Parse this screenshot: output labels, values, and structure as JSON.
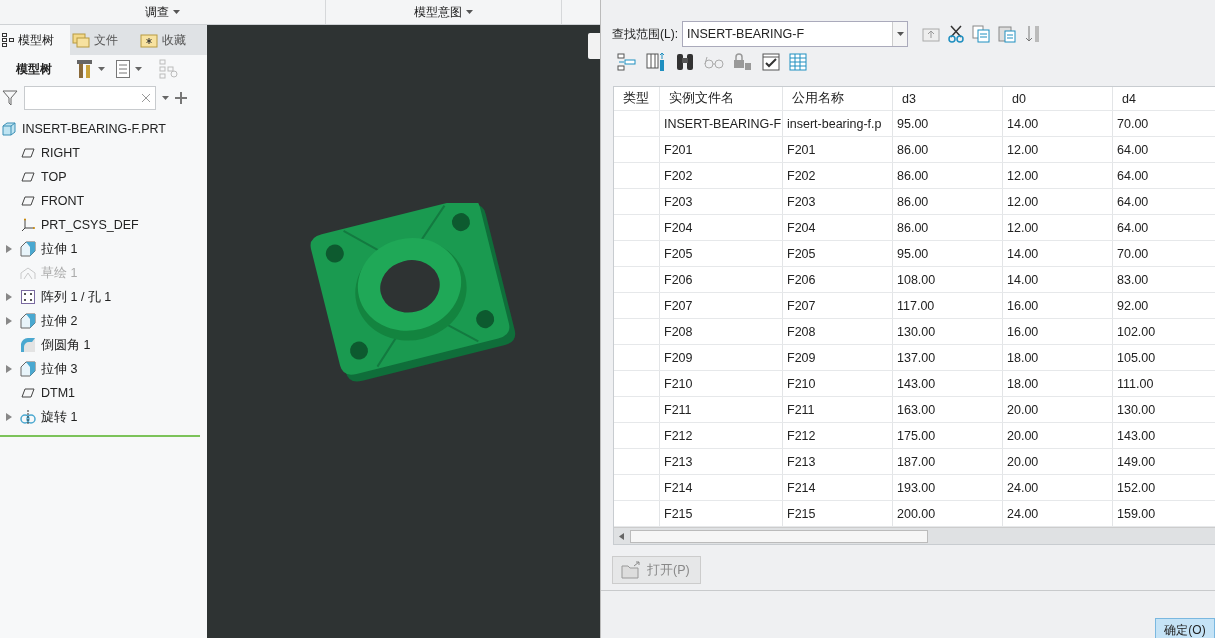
{
  "ribbon": {
    "groups": [
      {
        "label": "调查"
      },
      {
        "label": "模型意图"
      }
    ]
  },
  "navigator": {
    "tabs": [
      {
        "label": "模型树",
        "kind": "tree",
        "selected": true
      },
      {
        "label": "文件",
        "kind": "folder",
        "selected": false
      },
      {
        "label": "收藏",
        "kind": "favorites",
        "selected": false
      }
    ],
    "toolbar_label": "模型树",
    "tree": {
      "label": "INSERT-BEARING-F.PRT",
      "kind": "part",
      "children": [
        {
          "label": "RIGHT",
          "kind": "plane",
          "expandable": false,
          "disabled": false
        },
        {
          "label": "TOP",
          "kind": "plane",
          "expandable": false,
          "disabled": false
        },
        {
          "label": "FRONT",
          "kind": "plane",
          "expandable": false,
          "disabled": false
        },
        {
          "label": "PRT_CSYS_DEF",
          "kind": "csys",
          "expandable": false,
          "disabled": false
        },
        {
          "label": "拉伸 1",
          "kind": "extrude",
          "expandable": true,
          "disabled": false
        },
        {
          "label": "草绘 1",
          "kind": "sketch",
          "expandable": false,
          "disabled": true
        },
        {
          "label": "阵列 1 / 孔 1",
          "kind": "pattern",
          "expandable": true,
          "disabled": false
        },
        {
          "label": "拉伸 2",
          "kind": "extrude",
          "expandable": true,
          "disabled": false
        },
        {
          "label": "倒圆角 1",
          "kind": "round",
          "expandable": false,
          "disabled": false
        },
        {
          "label": "拉伸 3",
          "kind": "extrude",
          "expandable": true,
          "disabled": false
        },
        {
          "label": "DTM1",
          "kind": "plane",
          "expandable": false,
          "disabled": false
        },
        {
          "label": "旋转 1",
          "kind": "revolve",
          "expandable": true,
          "disabled": false
        }
      ]
    }
  },
  "dialog": {
    "lookin_label": "查找范围(L):",
    "lookin_value": "INSERT-BEARING-F",
    "table": {
      "columns": [
        "类型",
        "实例文件名",
        "公用名称",
        "d3",
        "d0",
        "d4"
      ],
      "rows": [
        {
          "file": "INSERT-BEARING-F",
          "common": "insert-bearing-f.p",
          "d3": "95.00",
          "d0": "14.00",
          "d4": "70.00"
        },
        {
          "file": "F201",
          "common": "F201",
          "d3": "86.00",
          "d0": "12.00",
          "d4": "64.00"
        },
        {
          "file": "F202",
          "common": "F202",
          "d3": "86.00",
          "d0": "12.00",
          "d4": "64.00"
        },
        {
          "file": "F203",
          "common": "F203",
          "d3": "86.00",
          "d0": "12.00",
          "d4": "64.00"
        },
        {
          "file": "F204",
          "common": "F204",
          "d3": "86.00",
          "d0": "12.00",
          "d4": "64.00"
        },
        {
          "file": "F205",
          "common": "F205",
          "d3": "95.00",
          "d0": "14.00",
          "d4": "70.00"
        },
        {
          "file": "F206",
          "common": "F206",
          "d3": "108.00",
          "d0": "14.00",
          "d4": "83.00"
        },
        {
          "file": "F207",
          "common": "F207",
          "d3": "117.00",
          "d0": "16.00",
          "d4": "92.00"
        },
        {
          "file": "F208",
          "common": "F208",
          "d3": "130.00",
          "d0": "16.00",
          "d4": "102.00"
        },
        {
          "file": "F209",
          "common": "F209",
          "d3": "137.00",
          "d0": "18.00",
          "d4": "105.00"
        },
        {
          "file": "F210",
          "common": "F210",
          "d3": "143.00",
          "d0": "18.00",
          "d4": "111.00"
        },
        {
          "file": "F211",
          "common": "F211",
          "d3": "163.00",
          "d0": "20.00",
          "d4": "130.00"
        },
        {
          "file": "F212",
          "common": "F212",
          "d3": "175.00",
          "d0": "20.00",
          "d4": "143.00"
        },
        {
          "file": "F213",
          "common": "F213",
          "d3": "187.00",
          "d0": "20.00",
          "d4": "149.00"
        },
        {
          "file": "F214",
          "common": "F214",
          "d3": "193.00",
          "d0": "24.00",
          "d4": "152.00"
        },
        {
          "file": "F215",
          "common": "F215",
          "d3": "200.00",
          "d0": "24.00",
          "d4": "159.00"
        }
      ]
    },
    "open_button": {
      "label": "打开(P)",
      "disabled": true
    },
    "ok_button": {
      "label": "确定(O)"
    }
  }
}
